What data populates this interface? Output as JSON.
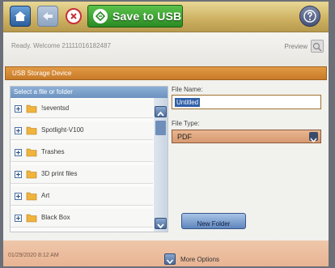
{
  "toolbar": {
    "save_label": "Save to USB",
    "icons": {
      "home": "home-icon",
      "back": "back-arrow-icon",
      "cancel": "cancel-icon",
      "save": "save-icon",
      "help": "help-icon"
    }
  },
  "status": {
    "ready_text": "Ready. Welcome 21111016182487",
    "preview_label": "Preview"
  },
  "storage": {
    "title": "USB Storage Device"
  },
  "file_pane": {
    "header": "Select a file or folder",
    "items": [
      {
        "label": "!seventsd"
      },
      {
        "label": "Spotlight-V100"
      },
      {
        "label": "Trashes"
      },
      {
        "label": "3D print files"
      },
      {
        "label": "Art"
      },
      {
        "label": "Black Box"
      }
    ]
  },
  "form": {
    "filename_label": "File Name:",
    "filename_value": "Untitled",
    "filetype_label": "File Type:",
    "filetype_value": "PDF",
    "new_folder_label": "New Folder"
  },
  "footer": {
    "datetime": "01/29/2020 8:12 AM",
    "more_options_label": "More Options"
  },
  "colors": {
    "toolbar": "#cdb060",
    "save_green": "#2a8a24",
    "header_orange": "#c77a28",
    "pane_blue": "#6c92bf",
    "footer": "#e8b493"
  }
}
